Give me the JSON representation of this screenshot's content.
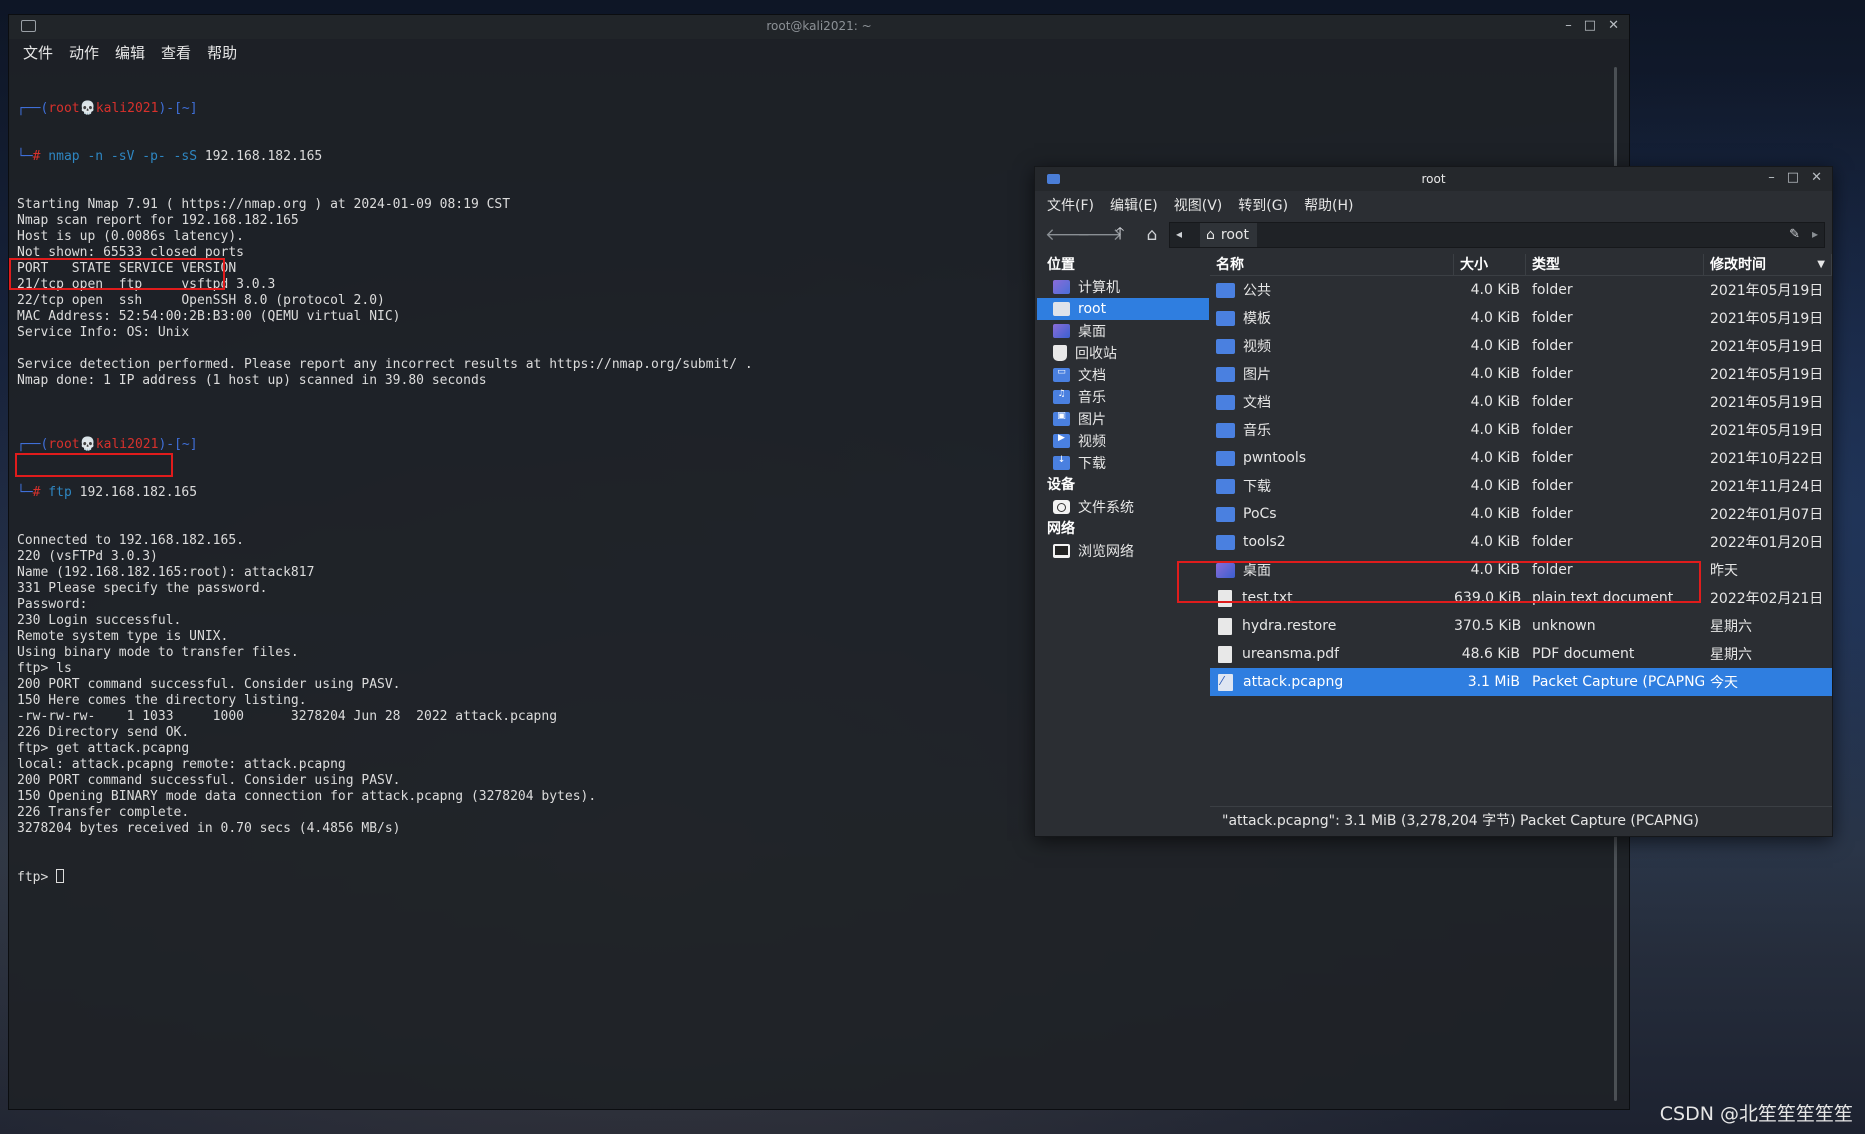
{
  "terminal": {
    "title": "root@kali2021: ~",
    "controls": [
      "–",
      "□",
      "✕"
    ],
    "menu": [
      "文件",
      "动作",
      "编辑",
      "查看",
      "帮助"
    ],
    "prompt": {
      "frame_top": "┌──(",
      "user": "root",
      "skull": "💀",
      "host": "kali2021",
      "dir_part": ")-[~]",
      "frame_bottom": "└─",
      "hash": "#"
    },
    "cmd1": {
      "name": " nmap ",
      "flags": "-n -sV -p- -sS",
      "args": " 192.168.182.165"
    },
    "nmap_output": [
      "Starting Nmap 7.91 ( https://nmap.org ) at 2024-01-09 08:19 CST",
      "Nmap scan report for 192.168.182.165",
      "Host is up (0.0086s latency).",
      "Not shown: 65533 closed ports",
      "PORT   STATE SERVICE VERSION",
      "21/tcp open  ftp     vsftpd 3.0.3",
      "22/tcp open  ssh     OpenSSH 8.0 (protocol 2.0)",
      "MAC Address: 52:54:00:2B:B3:00 (QEMU virtual NIC)",
      "Service Info: OS: Unix",
      "",
      "Service detection performed. Please report any incorrect results at https://nmap.org/submit/ .",
      "Nmap done: 1 IP address (1 host up) scanned in 39.80 seconds",
      ""
    ],
    "cmd2": {
      "name": " ftp",
      "args": " 192.168.182.165"
    },
    "ftp_output": [
      "Connected to 192.168.182.165.",
      "220 (vsFTPd 3.0.3)",
      "Name (192.168.182.165:root): attack817",
      "331 Please specify the password.",
      "Password:",
      "230 Login successful.",
      "Remote system type is UNIX.",
      "Using binary mode to transfer files.",
      "ftp> ls",
      "200 PORT command successful. Consider using PASV.",
      "150 Here comes the directory listing.",
      "-rw-rw-rw-    1 1033     1000      3278204 Jun 28  2022 attack.pcapng",
      "226 Directory send OK.",
      "ftp> get attack.pcapng",
      "local: attack.pcapng remote: attack.pcapng",
      "200 PORT command successful. Consider using PASV.",
      "150 Opening BINARY mode data connection for attack.pcapng (3278204 bytes).",
      "226 Transfer complete.",
      "3278204 bytes received in 0.70 secs (4.4856 MB/s)"
    ],
    "final_prompt": "ftp> "
  },
  "file_manager": {
    "title": "root",
    "controls": [
      "–",
      "□",
      "✕"
    ],
    "menu": [
      "文件(F)",
      "编辑(E)",
      "视图(V)",
      "转到(G)",
      "帮助(H)"
    ],
    "toolbar": {
      "back": "🡐",
      "forward": "🡒",
      "up": "🡑",
      "home": "⌂"
    },
    "path": {
      "home_icon": "⌂",
      "label": "root",
      "left_arrow": "◂",
      "right_arrow": "▸",
      "edit_icon": "✎"
    },
    "sidebar": {
      "places_header": "位置",
      "places": [
        {
          "label": "计算机",
          "icon": "computer-icon"
        },
        {
          "label": "root",
          "icon": "home-folder-icon",
          "selected": true
        },
        {
          "label": "桌面",
          "icon": "desktop-icon"
        },
        {
          "label": "回收站",
          "icon": "trash-icon"
        },
        {
          "label": "文档",
          "icon": "documents-folder-icon"
        },
        {
          "label": "音乐",
          "icon": "music-folder-icon"
        },
        {
          "label": "图片",
          "icon": "pictures-folder-icon"
        },
        {
          "label": "视频",
          "icon": "videos-folder-icon"
        },
        {
          "label": "下载",
          "icon": "downloads-folder-icon"
        }
      ],
      "devices_header": "设备",
      "devices": [
        {
          "label": "文件系统",
          "icon": "drive-icon"
        }
      ],
      "network_header": "网络",
      "network": [
        {
          "label": "浏览网络",
          "icon": "network-icon"
        }
      ]
    },
    "columns": {
      "name": "名称",
      "size": "大小",
      "type": "类型",
      "date": "修改时间"
    },
    "files": [
      {
        "name": "公共",
        "size": "4.0 KiB",
        "type": "folder",
        "date": "2021年05月19日",
        "icon": "folder"
      },
      {
        "name": "模板",
        "size": "4.0 KiB",
        "type": "folder",
        "date": "2021年05月19日",
        "icon": "folder"
      },
      {
        "name": "视频",
        "size": "4.0 KiB",
        "type": "folder",
        "date": "2021年05月19日",
        "icon": "folder"
      },
      {
        "name": "图片",
        "size": "4.0 KiB",
        "type": "folder",
        "date": "2021年05月19日",
        "icon": "folder"
      },
      {
        "name": "文档",
        "size": "4.0 KiB",
        "type": "folder",
        "date": "2021年05月19日",
        "icon": "folder"
      },
      {
        "name": "音乐",
        "size": "4.0 KiB",
        "type": "folder",
        "date": "2021年05月19日",
        "icon": "folder"
      },
      {
        "name": "pwntools",
        "size": "4.0 KiB",
        "type": "folder",
        "date": "2021年10月22日",
        "icon": "folder"
      },
      {
        "name": "下载",
        "size": "4.0 KiB",
        "type": "folder",
        "date": "2021年11月24日",
        "icon": "folder"
      },
      {
        "name": "PoCs",
        "size": "4.0 KiB",
        "type": "folder",
        "date": "2022年01月07日",
        "icon": "folder"
      },
      {
        "name": "tools2",
        "size": "4.0 KiB",
        "type": "folder",
        "date": "2022年01月20日",
        "icon": "folder"
      },
      {
        "name": "桌面",
        "size": "4.0 KiB",
        "type": "folder",
        "date": "昨天",
        "icon": "desktop"
      },
      {
        "name": "test.txt",
        "size": "639.0 KiB",
        "type": "plain text document",
        "date": "2022年02月21日",
        "icon": "doc"
      },
      {
        "name": "hydra.restore",
        "size": "370.5 KiB",
        "type": "unknown",
        "date": "星期六",
        "icon": "doc"
      },
      {
        "name": "ureansma.pdf",
        "size": "48.6 KiB",
        "type": "PDF document",
        "date": "星期六",
        "icon": "doc"
      },
      {
        "name": "attack.pcapng",
        "size": "3.1 MiB",
        "type": "Packet Capture (PCAPNG)",
        "date": "今天",
        "icon": "pcap",
        "selected": true
      }
    ],
    "status": "\"attack.pcapng\": 3.1 MiB (3,278,204 字节) Packet Capture (PCAPNG)"
  },
  "watermark": "CSDN @北笙笙笙笙笙",
  "colors": {
    "accent": "#2f7ee0",
    "highlight_box": "#e01c1c",
    "prompt_red": "#d8312c",
    "prompt_blue": "#3f6fd8"
  }
}
